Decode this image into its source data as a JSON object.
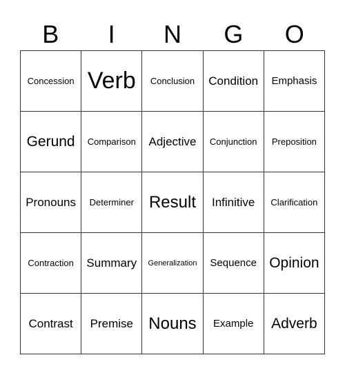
{
  "header": [
    "B",
    "I",
    "N",
    "G",
    "O"
  ],
  "rows": [
    [
      {
        "text": "Concession",
        "size": "s-s"
      },
      {
        "text": "Verb",
        "size": "s-xxl"
      },
      {
        "text": "Conclusion",
        "size": "s-s"
      },
      {
        "text": "Condition",
        "size": "s-ml"
      },
      {
        "text": "Emphasis",
        "size": "s-m"
      }
    ],
    [
      {
        "text": "Gerund",
        "size": "s-l"
      },
      {
        "text": "Comparison",
        "size": "s-s"
      },
      {
        "text": "Adjective",
        "size": "s-ml"
      },
      {
        "text": "Conjunction",
        "size": "s-s"
      },
      {
        "text": "Preposition",
        "size": "s-s"
      }
    ],
    [
      {
        "text": "Pronouns",
        "size": "s-ml"
      },
      {
        "text": "Determiner",
        "size": "s-s"
      },
      {
        "text": "Result",
        "size": "s-xl"
      },
      {
        "text": "Infinitive",
        "size": "s-ml"
      },
      {
        "text": "Clarification",
        "size": "s-s"
      }
    ],
    [
      {
        "text": "Contraction",
        "size": "s-s"
      },
      {
        "text": "Summary",
        "size": "s-ml"
      },
      {
        "text": "Generalization",
        "size": "s-xs"
      },
      {
        "text": "Sequence",
        "size": "s-m"
      },
      {
        "text": "Opinion",
        "size": "s-l"
      }
    ],
    [
      {
        "text": "Contrast",
        "size": "s-ml"
      },
      {
        "text": "Premise",
        "size": "s-ml"
      },
      {
        "text": "Nouns",
        "size": "s-xl"
      },
      {
        "text": "Example",
        "size": "s-m"
      },
      {
        "text": "Adverb",
        "size": "s-l"
      }
    ]
  ]
}
